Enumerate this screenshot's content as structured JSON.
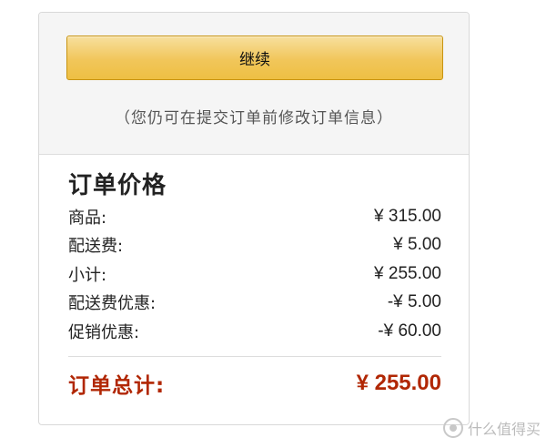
{
  "actions": {
    "continue_label": "继续",
    "note": "（您仍可在提交订单前修改订单信息）"
  },
  "summary": {
    "title": "订单价格",
    "rows": [
      {
        "label": "商品:",
        "amount": "¥ 315.00"
      },
      {
        "label": "配送费:",
        "amount": "¥ 5.00"
      },
      {
        "label": "小计:",
        "amount": "¥ 255.00"
      },
      {
        "label": "配送费优惠:",
        "amount": "-¥ 5.00"
      },
      {
        "label": "促销优惠:",
        "amount": "-¥ 60.00"
      }
    ],
    "total": {
      "label": "订单总计:",
      "amount": "¥ 255.00"
    }
  },
  "watermark": {
    "icon": "smzdm-logo",
    "text": "什么值得买"
  },
  "colors": {
    "button_top": "#f7e09e",
    "button_bottom": "#eebf43",
    "button_border": "#c89411",
    "total_red": "#b12704"
  }
}
